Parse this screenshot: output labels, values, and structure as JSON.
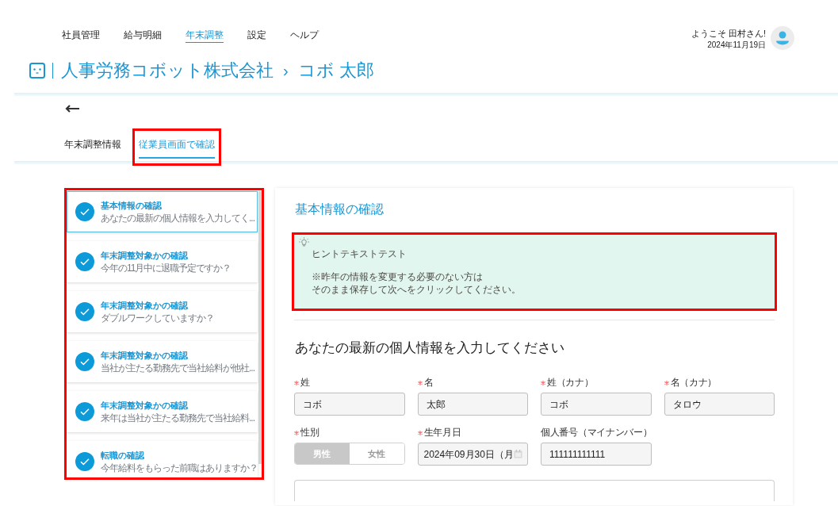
{
  "nav": {
    "items": [
      {
        "label": "社員管理",
        "selected": false
      },
      {
        "label": "給与明細",
        "selected": false
      },
      {
        "label": "年末調整",
        "selected": true
      },
      {
        "label": "設定",
        "selected": false
      },
      {
        "label": "ヘルプ",
        "selected": false
      }
    ]
  },
  "user": {
    "greeting": "ようこそ 田村さん!",
    "date": "2024年11月19日"
  },
  "breadcrumb": {
    "company": "人事労務コボット株式会社",
    "separator": "›",
    "employee": "コボ 太郎"
  },
  "tabs": [
    {
      "label": "年末調整情報",
      "selected": false,
      "highlighted": false
    },
    {
      "label": "従業員画面で確認",
      "selected": true,
      "highlighted": true
    }
  ],
  "steps": {
    "highlighted": true,
    "items": [
      {
        "title": "基本情報の確認",
        "subtitle": "あなたの最新の個人情報を入力してく...",
        "selected": true,
        "done": true
      },
      {
        "title": "年末調整対象かの確認",
        "subtitle": "今年の11月中に退職予定ですか？",
        "selected": false,
        "done": true
      },
      {
        "title": "年末調整対象かの確認",
        "subtitle": "ダブルワークしていますか？",
        "selected": false,
        "done": true
      },
      {
        "title": "年末調整対象かの確認",
        "subtitle": "当社が主たる勤務先で当社給料が他社...",
        "selected": false,
        "done": true
      },
      {
        "title": "年末調整対象かの確認",
        "subtitle": "来年は当社が主たる勤務先で当社給料...",
        "selected": false,
        "done": true
      },
      {
        "title": "転職の確認",
        "subtitle": "今年給料をもらった前職はありますか？",
        "selected": false,
        "done": true
      }
    ]
  },
  "section": {
    "title": "基本情報の確認",
    "hint": {
      "highlighted": true,
      "paragraphs": [
        [
          "ヒントテキストテスト"
        ],
        [
          "※昨年の情報を変更する必要のない方は",
          "そのまま保存して次へをクリックしてください。"
        ]
      ]
    }
  },
  "form": {
    "heading": "あなたの最新の個人情報を入力してください",
    "rows": [
      [
        {
          "kind": "text",
          "label": "姓",
          "required": true,
          "value": "コボ"
        },
        {
          "kind": "text",
          "label": "名",
          "required": true,
          "value": "太郎"
        },
        {
          "kind": "text",
          "label": "姓（カナ）",
          "required": true,
          "value": "コボ"
        },
        {
          "kind": "text",
          "label": "名（カナ）",
          "required": true,
          "value": "タロウ"
        }
      ],
      [
        {
          "kind": "segmented",
          "label": "性別",
          "required": true,
          "options": [
            {
              "label": "男性",
              "selected": true
            },
            {
              "label": "女性",
              "selected": false
            }
          ]
        },
        {
          "kind": "date",
          "label": "生年月日",
          "required": true,
          "value": "2024年09月30日（月"
        },
        {
          "kind": "text",
          "label": "個人番号（マイナンバー）",
          "required": false,
          "value": "111111111111"
        }
      ]
    ],
    "continues": true
  }
}
